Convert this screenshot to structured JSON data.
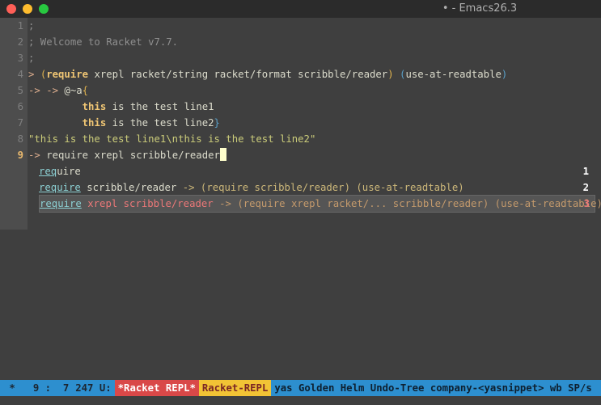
{
  "window": {
    "title": "• - Emacs26.3",
    "traffic_lights": [
      {
        "name": "close",
        "color": "#ff5f57"
      },
      {
        "name": "minimize",
        "color": "#febc2e"
      },
      {
        "name": "zoom",
        "color": "#28c840"
      }
    ]
  },
  "lines": [
    {
      "num": "1",
      "segments": [
        {
          "text": ";",
          "cls": "c-comment"
        }
      ]
    },
    {
      "num": "2",
      "segments": [
        {
          "text": "; Welcome to Racket v7.7.",
          "cls": "c-comment"
        }
      ]
    },
    {
      "num": "3",
      "segments": [
        {
          "text": ";",
          "cls": "c-comment"
        }
      ]
    },
    {
      "num": "4",
      "segments": [
        {
          "text": "> ",
          "cls": "c-prompt"
        },
        {
          "text": "(",
          "cls": "c-paren"
        },
        {
          "text": "require",
          "cls": "c-keyword"
        },
        {
          "text": " xrepl racket/string racket/format scribble/reader",
          "cls": "c-text"
        },
        {
          "text": ")",
          "cls": "c-paren"
        },
        {
          "text": " ",
          "cls": "c-text"
        },
        {
          "text": "(",
          "cls": "c-paren2"
        },
        {
          "text": "use-at-readtable",
          "cls": "c-text"
        },
        {
          "text": ")",
          "cls": "c-paren2"
        }
      ]
    },
    {
      "num": "5",
      "segments": [
        {
          "text": "-> -> ",
          "cls": "c-prompt"
        },
        {
          "text": "@~a",
          "cls": "c-text"
        },
        {
          "text": "{",
          "cls": "c-paren"
        }
      ]
    },
    {
      "num": "6",
      "segments": [
        {
          "text": "         ",
          "cls": "c-text"
        },
        {
          "text": "this",
          "cls": "c-keyword"
        },
        {
          "text": " is the test line1",
          "cls": "c-text"
        }
      ]
    },
    {
      "num": "7",
      "segments": [
        {
          "text": "         ",
          "cls": "c-text"
        },
        {
          "text": "this",
          "cls": "c-keyword"
        },
        {
          "text": " is the test line2",
          "cls": "c-text"
        },
        {
          "text": "}",
          "cls": "c-paren2"
        }
      ]
    },
    {
      "num": "8",
      "segments": [
        {
          "text": "\"this is the test line1\\nthis is the test line2\"",
          "cls": "c-string"
        }
      ]
    },
    {
      "num": "9",
      "current": true,
      "segments": [
        {
          "text": "-> ",
          "cls": "c-prompt"
        },
        {
          "text": "require xrepl scribble/reader",
          "cls": "c-text"
        }
      ]
    }
  ],
  "completions": [
    {
      "match": "req",
      "rest": "uire",
      "annotation": "",
      "number": "1",
      "selected": false
    },
    {
      "match": "require",
      "rest": " scribble/reader",
      "annotation": " -> (require scribble/reader) (use-at-readtable)",
      "number": "2",
      "selected": false
    },
    {
      "match": "require",
      "rest": " xrepl scribble/reader",
      "annotation": " -> (require xrepl racket/... scribble/reader) (use-at-readtable)",
      "number": "3",
      "selected": true
    }
  ],
  "modeline": {
    "status": " *",
    "position": "9 :  7",
    "size": "247 U:",
    "buffer": "*Racket REPL*",
    "major_mode": "Racket-REPL",
    "minor_modes": "yas Golden Helm Undo-Tree company-<yasnippet> wb SP/s"
  }
}
